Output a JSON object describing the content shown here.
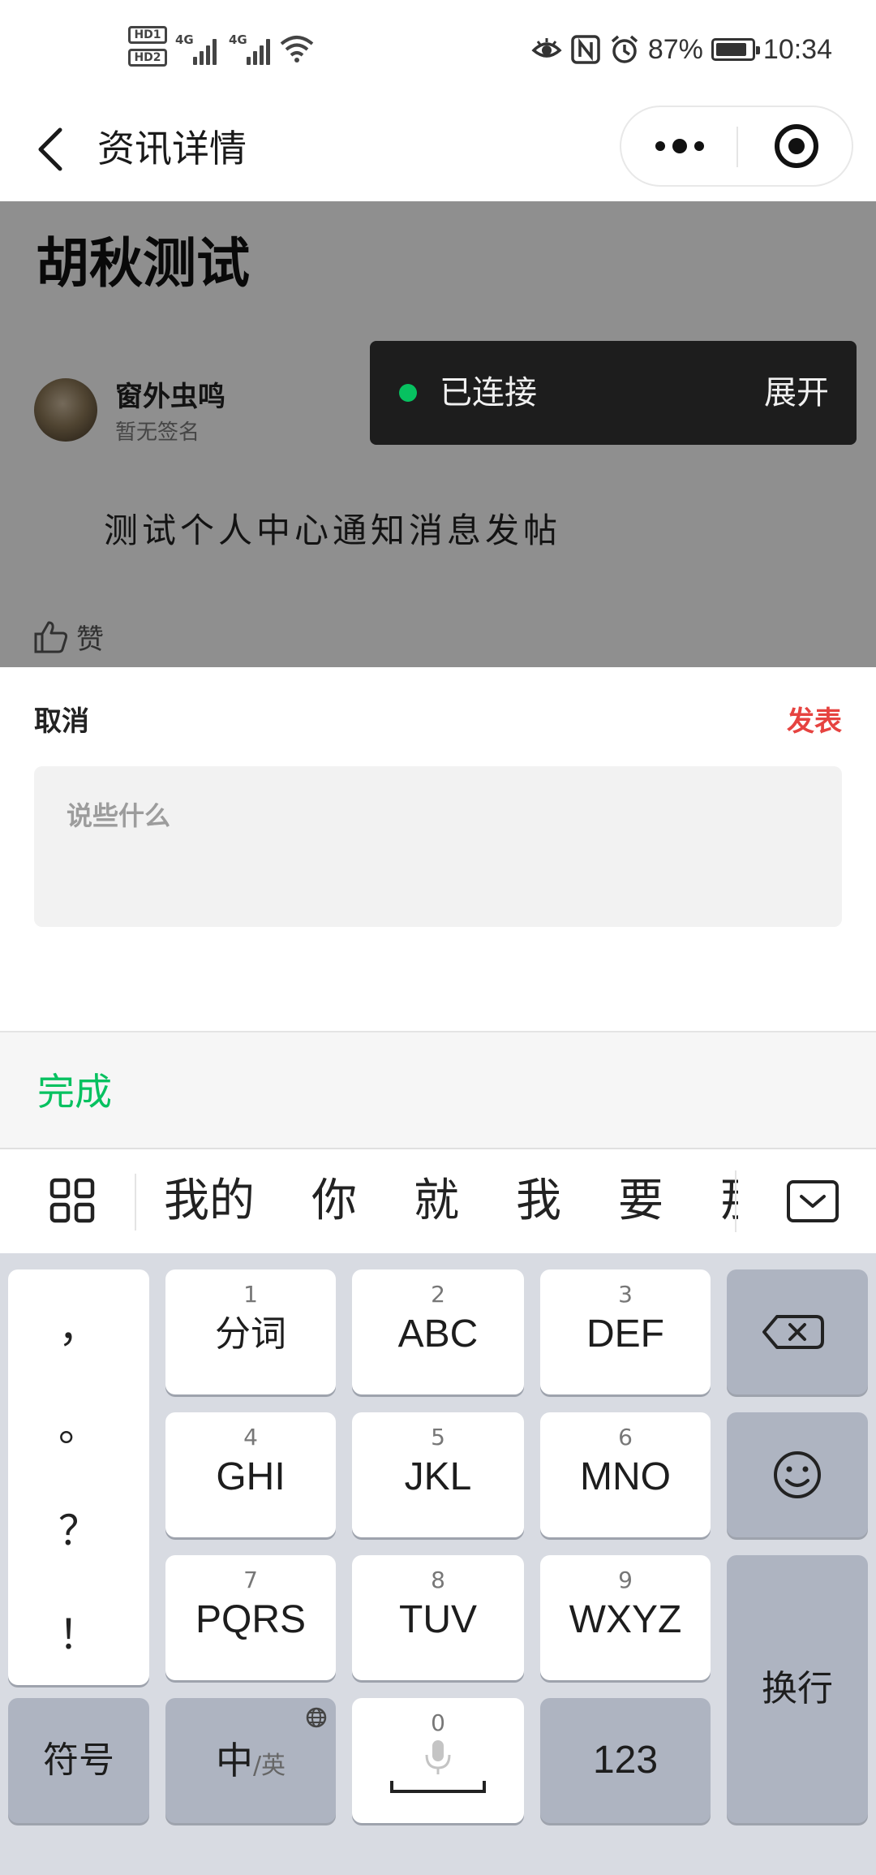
{
  "status_bar": {
    "hd1": "HD1",
    "hd2": "HD2",
    "signal1_tag": "4G",
    "signal2_tag": "4G",
    "battery_percent": "87%",
    "time": "10:34",
    "battery_level": 0.87,
    "icons": [
      "eye-comfort-icon",
      "nfc-icon",
      "alarm-icon",
      "wifi-icon"
    ]
  },
  "nav": {
    "title": "资讯详情",
    "back_icon": "chevron-left-icon",
    "more_icon": "more-dots-icon",
    "close_icon": "target-close-icon"
  },
  "article": {
    "title": "胡秋测试",
    "author_name": "窗外虫鸣",
    "author_signature": "暂无签名",
    "body": "测试个人中心通知消息发帖",
    "like_label": "赞"
  },
  "toast": {
    "status": "已连接",
    "action": "展开",
    "status_color": "#07c160"
  },
  "comment": {
    "cancel_label": "取消",
    "publish_label": "发表",
    "placeholder": "说些什么",
    "publish_color": "#e64340"
  },
  "done_bar": {
    "done_label": "完成",
    "done_color": "#07c160"
  },
  "candidates": {
    "items": [
      "我的",
      "你",
      "就",
      "我",
      "要",
      "那"
    ]
  },
  "keyboard": {
    "punctuation": [
      "，",
      "。",
      "？",
      "！"
    ],
    "keys": [
      {
        "num": "1",
        "label": "分词"
      },
      {
        "num": "2",
        "label": "ABC"
      },
      {
        "num": "3",
        "label": "DEF"
      },
      {
        "num": "4",
        "label": "GHI"
      },
      {
        "num": "5",
        "label": "JKL"
      },
      {
        "num": "6",
        "label": "MNO"
      },
      {
        "num": "7",
        "label": "PQRS"
      },
      {
        "num": "8",
        "label": "TUV"
      },
      {
        "num": "9",
        "label": "WXYZ"
      }
    ],
    "symbols_label": "符号",
    "lang_main": "中",
    "lang_alt": "/英",
    "space_num": "0",
    "numbers_label": "123",
    "enter_label": "换行"
  }
}
